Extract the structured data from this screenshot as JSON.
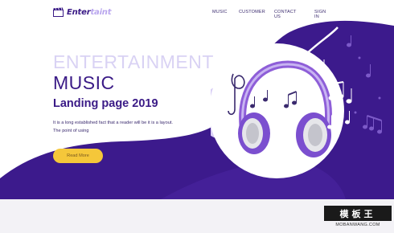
{
  "header": {
    "logo_main": "Enter",
    "logo_light": "taint",
    "nav": [
      {
        "label": "MUSIC"
      },
      {
        "label": "CUSTOMER"
      },
      {
        "label": "CONTACT US"
      },
      {
        "label": "SIGN IN"
      }
    ]
  },
  "hero": {
    "line1": "ENTERTAINMENT",
    "line2": "MUSIC",
    "line3": "Landing page 2019",
    "paragraph_line1": "It is a long established fact that a reader will be it is a layout.",
    "paragraph_line2": "The point of using",
    "cta_label": "Read More"
  },
  "watermark": {
    "logo_text": "模板王",
    "url": "MOBANWANG.COM"
  },
  "colors": {
    "brand_purple": "#3a1a86",
    "light_purple": "#d9d2f4",
    "accent_yellow": "#f5c73a"
  }
}
